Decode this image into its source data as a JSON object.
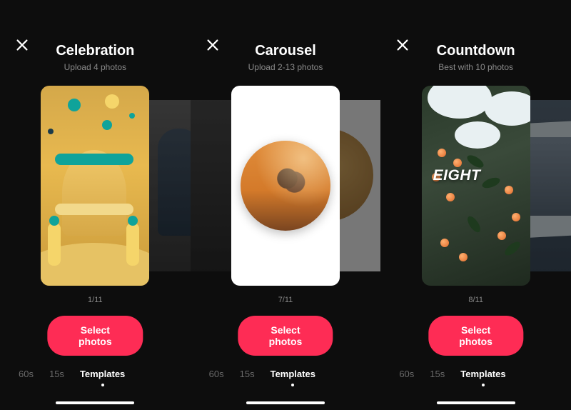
{
  "screens": [
    {
      "title": "Celebration",
      "subtitle": "Upload 4 photos",
      "counter": "1/11",
      "button_label": "Select photos"
    },
    {
      "title": "Carousel",
      "subtitle": "Upload 2-13 photos",
      "counter": "7/11",
      "button_label": "Select photos"
    },
    {
      "title": "Countdown",
      "subtitle": "Best with 10 photos",
      "counter": "8/11",
      "button_label": "Select photos",
      "overlay_text": "EIGHT"
    }
  ],
  "tabs": {
    "items": [
      "60s",
      "15s",
      "Templates"
    ],
    "active_index": 2
  },
  "colors": {
    "accent": "#fe2c55",
    "bg": "#0d0d0d"
  }
}
